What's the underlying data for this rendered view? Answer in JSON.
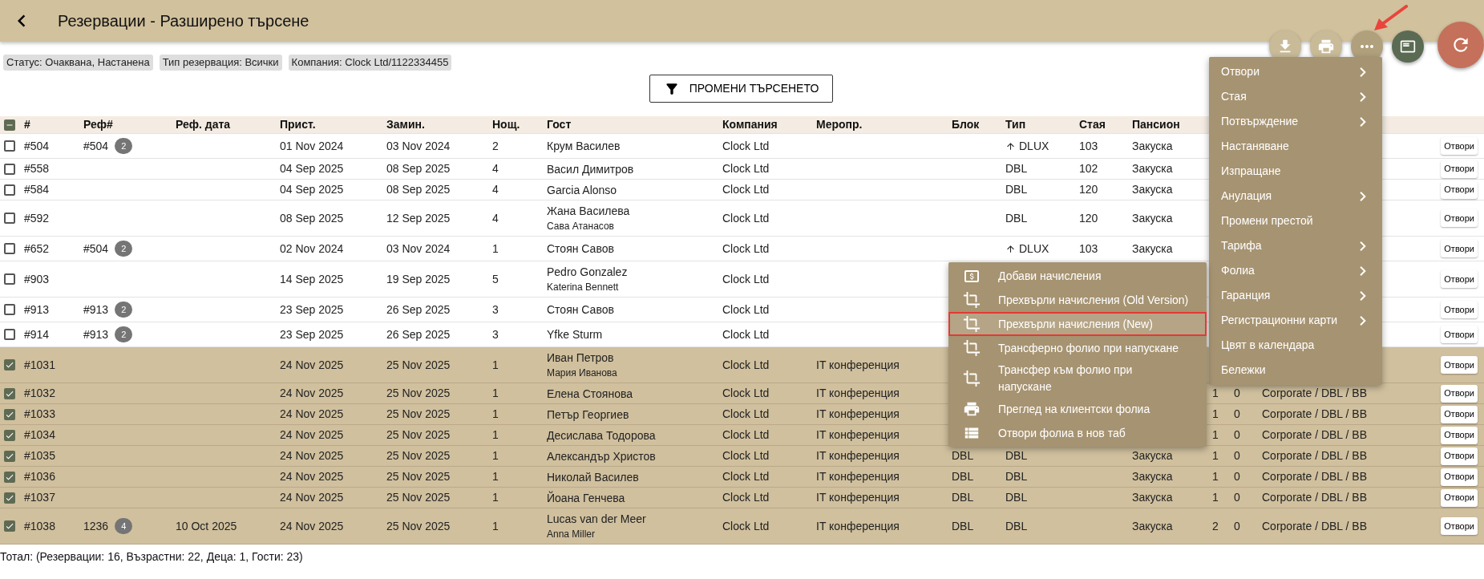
{
  "header": {
    "title": "Резервации - Разширено търсене"
  },
  "filters": [
    "Статус: Очаквана, Настанена",
    "Тип резервация: Всички",
    "Компания: Clock Ltd/1122334455"
  ],
  "search_button": "ПРОМЕНИ ТЪРСЕНЕТО",
  "table": {
    "select_all": {
      "indeterminate": true
    },
    "columns": [
      "#",
      "Реф#",
      "Реф. дата",
      "Прист.",
      "Замин.",
      "Нощ.",
      "Гост",
      "Компания",
      "Меропр.",
      "Блок",
      "Тип",
      "Стая",
      "Пансион"
    ],
    "rows": [
      {
        "selected": false,
        "number": "#504",
        "ref": "#504",
        "ref_count": "2",
        "arrival": "01 Nov 2024",
        "departure": "03 Nov 2024",
        "nights": "2",
        "guest": "Крум Василев",
        "company": "Clock Ltd",
        "type": "DLUX",
        "type_upgraded": true,
        "room": "103",
        "board": "Закуска",
        "action": "Отвори"
      },
      {
        "selected": false,
        "number": "#558",
        "arrival": "04 Sep 2025",
        "departure": "08 Sep 2025",
        "nights": "4",
        "guest": "Васил Димитров",
        "company": "Clock Ltd",
        "type": "DBL",
        "type_upgraded": false,
        "room": "102",
        "board": "Закуска",
        "action": "Отвори"
      },
      {
        "selected": false,
        "number": "#584",
        "arrival": "04 Sep 2025",
        "departure": "08 Sep 2025",
        "nights": "4",
        "guest": "Garcia Alonso",
        "company": "Clock Ltd",
        "type": "DBL",
        "type_upgraded": false,
        "room": "120",
        "board": "Закуска",
        "action": "Отвори"
      },
      {
        "selected": false,
        "number": "#592",
        "arrival": "08 Sep 2025",
        "departure": "12 Sep 2025",
        "nights": "4",
        "guest": "Жана Василева",
        "guest_2": "Сава Атанасов",
        "company": "Clock Ltd",
        "type": "DBL",
        "type_upgraded": false,
        "room": "120",
        "board": "Закуска",
        "action": "Отвори"
      },
      {
        "selected": false,
        "number": "#652",
        "ref": "#504",
        "ref_count": "2",
        "arrival": "02 Nov 2024",
        "departure": "03 Nov 2024",
        "nights": "1",
        "guest": "Стоян Савов",
        "company": "Clock Ltd",
        "type": "DLUX",
        "type_upgraded": true,
        "room": "103",
        "board": "Закуска",
        "action": "Отвори"
      },
      {
        "selected": false,
        "number": "#903",
        "arrival": "14 Sep 2025",
        "departure": "19 Sep 2025",
        "nights": "5",
        "guest": "Pedro Gonzalez",
        "guest_2": "Katerina Bennett",
        "company": "Clock Ltd",
        "action": "Отвори"
      },
      {
        "selected": false,
        "number": "#913",
        "ref": "#913",
        "ref_count": "2",
        "arrival": "23 Sep 2025",
        "departure": "26 Sep 2025",
        "nights": "3",
        "guest": "Стоян Савов",
        "company": "Clock Ltd",
        "action": "Отвори"
      },
      {
        "selected": false,
        "number": "#914",
        "ref": "#913",
        "ref_count": "2",
        "arrival": "23 Sep 2025",
        "departure": "26 Sep 2025",
        "nights": "3",
        "guest": "Yfke Sturm",
        "company": "Clock Ltd",
        "action": "Отвори"
      },
      {
        "selected": true,
        "number": "#1031",
        "arrival": "24 Nov 2025",
        "departure": "25 Nov 2025",
        "nights": "1",
        "guest": "Иван Петров",
        "guest_2": "Мария Иванова",
        "company": "Clock Ltd",
        "event": "IT конференция",
        "action": "Отвори"
      },
      {
        "selected": true,
        "number": "#1032",
        "arrival": "24 Nov 2025",
        "departure": "25 Nov 2025",
        "nights": "1",
        "guest": "Елена Стоянова",
        "company": "Clock Ltd",
        "event": "IT конференция",
        "column_15": "1",
        "column_16": "0",
        "column_17": "Corporate / DBL / BB",
        "action": "Отвори"
      },
      {
        "selected": true,
        "number": "#1033",
        "arrival": "24 Nov 2025",
        "departure": "25 Nov 2025",
        "nights": "1",
        "guest": "Петър Георгиев",
        "company": "Clock Ltd",
        "event": "IT конференция",
        "column_15": "1",
        "column_16": "0",
        "column_17": "Corporate / DBL / BB",
        "action": "Отвори"
      },
      {
        "selected": true,
        "number": "#1034",
        "arrival": "24 Nov 2025",
        "departure": "25 Nov 2025",
        "nights": "1",
        "guest": "Десислава Тодорова",
        "company": "Clock Ltd",
        "event": "IT конференция",
        "column_15": "1",
        "column_16": "0",
        "column_17": "Corporate / DBL / BB",
        "action": "Отвори"
      },
      {
        "selected": true,
        "number": "#1035",
        "arrival": "24 Nov 2025",
        "departure": "25 Nov 2025",
        "nights": "1",
        "guest": "Александър Христов",
        "company": "Clock Ltd",
        "event": "IT конференция",
        "block": "DBL",
        "type": "DBL",
        "type_upgraded": false,
        "board": "Закуска",
        "column_15": "1",
        "column_16": "0",
        "column_17": "Corporate / DBL / BB",
        "action": "Отвори"
      },
      {
        "selected": true,
        "number": "#1036",
        "arrival": "24 Nov 2025",
        "departure": "25 Nov 2025",
        "nights": "1",
        "guest": "Николай Василев",
        "company": "Clock Ltd",
        "event": "IT конференция",
        "block": "DBL",
        "type": "DBL",
        "type_upgraded": false,
        "board": "Закуска",
        "column_15": "1",
        "column_16": "0",
        "column_17": "Corporate / DBL / BB",
        "action": "Отвори"
      },
      {
        "selected": true,
        "number": "#1037",
        "arrival": "24 Nov 2025",
        "departure": "25 Nov 2025",
        "nights": "1",
        "guest": "Йоана Генчева",
        "company": "Clock Ltd",
        "event": "IT конференция",
        "block": "DBL",
        "type": "DBL",
        "type_upgraded": false,
        "board": "Закуска",
        "column_15": "1",
        "column_16": "0",
        "column_17": "Corporate / DBL / BB",
        "action": "Отвори"
      },
      {
        "selected": true,
        "number": "#1038",
        "ref": "1236",
        "ref_count": "4",
        "ref_date": "10 Oct 2025",
        "arrival": "24 Nov 2025",
        "departure": "25 Nov 2025",
        "nights": "1",
        "guest": "Lucas van der Meer",
        "guest_2": "Anna Miller",
        "company": "Clock Ltd",
        "event": "IT конференция",
        "block": "DBL",
        "type": "DBL",
        "type_upgraded": false,
        "board": "Закуска",
        "column_15": "2",
        "column_16": "0",
        "column_17": "Corporate / DBL / BB",
        "action": "Отвори"
      }
    ]
  },
  "total": "Тотал: (Резервации: 16, Възрастни: 22, Деца: 1, Гости: 23)",
  "menu": {
    "items": [
      {
        "label": "Отвори",
        "submenu": true
      },
      {
        "label": "Стая",
        "submenu": true
      },
      {
        "label": "Потвърждение",
        "submenu": true
      },
      {
        "label": "Настаняване",
        "submenu": false
      },
      {
        "label": "Изпращане",
        "submenu": false
      },
      {
        "label": "Анулация",
        "submenu": true
      },
      {
        "label": "Промени престой",
        "submenu": false
      },
      {
        "label": "Тарифа",
        "submenu": true
      },
      {
        "label": "Фолиа",
        "submenu": true
      },
      {
        "label": "Гаранция",
        "submenu": true
      },
      {
        "label": "Регистрационни карти",
        "submenu": true
      },
      {
        "label": "Цвят в календара",
        "submenu": false
      },
      {
        "label": "Бележки",
        "submenu": false
      }
    ]
  },
  "submenu": {
    "items": [
      {
        "kind": "charge",
        "label": "Добави начисления",
        "selected": false
      },
      {
        "kind": "transfer",
        "label": "Прехвърли начисления (Old Version)",
        "selected": false
      },
      {
        "kind": "transfer",
        "label": "Прехвърли начисления (New)",
        "selected": true
      },
      {
        "kind": "transfer",
        "label": "Трансферно фолио при напускане",
        "selected": false
      },
      {
        "kind": "transfer",
        "label": "Трансфер към фолио при\nнапускане",
        "selected": false
      },
      {
        "kind": "print",
        "label": "Преглед на клиентски фолиа",
        "selected": false
      },
      {
        "kind": "list",
        "label": "Отвори фолиа в нов таб",
        "selected": false
      }
    ]
  }
}
